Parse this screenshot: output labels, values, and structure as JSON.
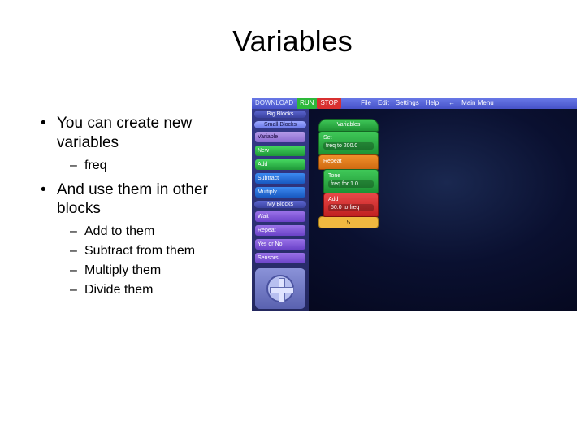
{
  "slide": {
    "title": "Variables",
    "bullets": [
      {
        "text": "You can create new variables",
        "sub": [
          "freq"
        ]
      },
      {
        "text": "And use them in other blocks",
        "sub": [
          "Add to them",
          "Subtract from them",
          "Multiply them",
          "Divide them"
        ]
      }
    ]
  },
  "app": {
    "menubar": {
      "download": "DOWNLOAD",
      "run": "RUN",
      "stop": "STOP",
      "file": "File",
      "edit": "Edit",
      "settings": "Settings",
      "help": "Help",
      "main_menu": "Main Menu"
    },
    "palette": {
      "big_blocks": "Big Blocks",
      "small_blocks": "Small Blocks",
      "category": "Variable",
      "ops": {
        "new": "New",
        "add": "Add",
        "subtract": "Subtract",
        "multiply": "Multiply"
      },
      "my_blocks": "My Blocks",
      "user_blocks": {
        "wait": "Wait",
        "repeat": "Repeat",
        "yes_or_no": "Yes or No",
        "sensors": "Sensors"
      }
    },
    "program": {
      "variables_hat": "Variables",
      "set_label": "Set",
      "set_value": "freq to 200.0",
      "repeat_label": "Repeat",
      "tone_label": "Tone",
      "tone_value": "freq for 1.0",
      "add_label": "Add",
      "add_value": "50.0 to freq",
      "repeat_count": "5"
    }
  }
}
